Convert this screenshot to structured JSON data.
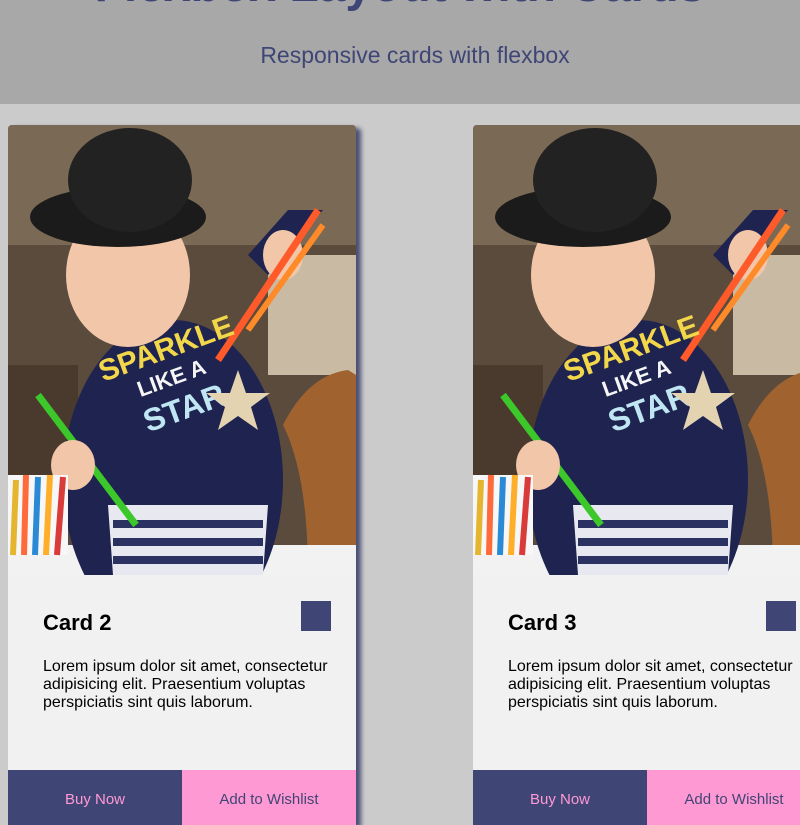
{
  "header": {
    "title": "Flexbox Layout with Cards",
    "subtitle": "Responsive cards with flexbox"
  },
  "colors": {
    "accent": "#3f4675",
    "pink": "#ff99d4",
    "header_bg": "#a8a8a8",
    "page_bg": "#cbcbcb",
    "card_bg": "#f1f1f2"
  },
  "cards": [
    {
      "title": "Card 2",
      "text": "Lorem ipsum dolor sit amet, consectetur adipisicing elit. Praesentium voluptas perspiciatis sint quis laborum.",
      "buy_label": "Buy Now",
      "wish_label": "Add to Wishlist",
      "image_shirt_text": [
        "SPARKLE",
        "LIKE A",
        "STAR"
      ]
    },
    {
      "title": "Card 3",
      "text": "Lorem ipsum dolor sit amet, consectetur adipisicing elit. Praesentium voluptas perspiciatis sint quis laborum.",
      "buy_label": "Buy Now",
      "wish_label": "Add to Wishlist",
      "image_shirt_text": [
        "SPARKLE",
        "LIKE A",
        "STAR"
      ]
    }
  ]
}
